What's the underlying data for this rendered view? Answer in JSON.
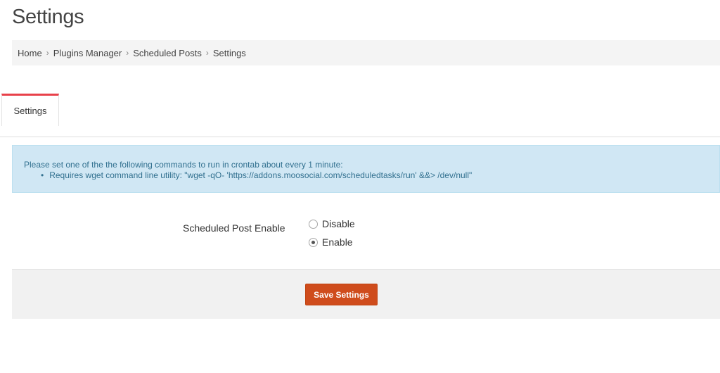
{
  "page": {
    "title": "Settings"
  },
  "breadcrumb": {
    "items": [
      {
        "label": "Home"
      },
      {
        "label": "Plugins Manager"
      },
      {
        "label": "Scheduled Posts"
      },
      {
        "label": "Settings"
      }
    ],
    "separator": "›"
  },
  "tabs": [
    {
      "label": "Settings",
      "active": true
    }
  ],
  "info": {
    "message": "Please set one of the the following commands to run in crontab about every 1 minute:",
    "items": [
      "Requires wget command line utility: \"wget -qO- 'https://addons.moosocial.com/scheduledtasks/run' &&> /dev/null\""
    ]
  },
  "form": {
    "field_label": "Scheduled Post Enable",
    "options": [
      {
        "label": "Disable",
        "checked": false
      },
      {
        "label": "Enable",
        "checked": true
      }
    ],
    "save_label": "Save Settings"
  },
  "colors": {
    "tab_accent": "#e8414a",
    "save_button": "#cf4c1c",
    "info_bg": "#d0e7f4",
    "info_text": "#31708f"
  }
}
